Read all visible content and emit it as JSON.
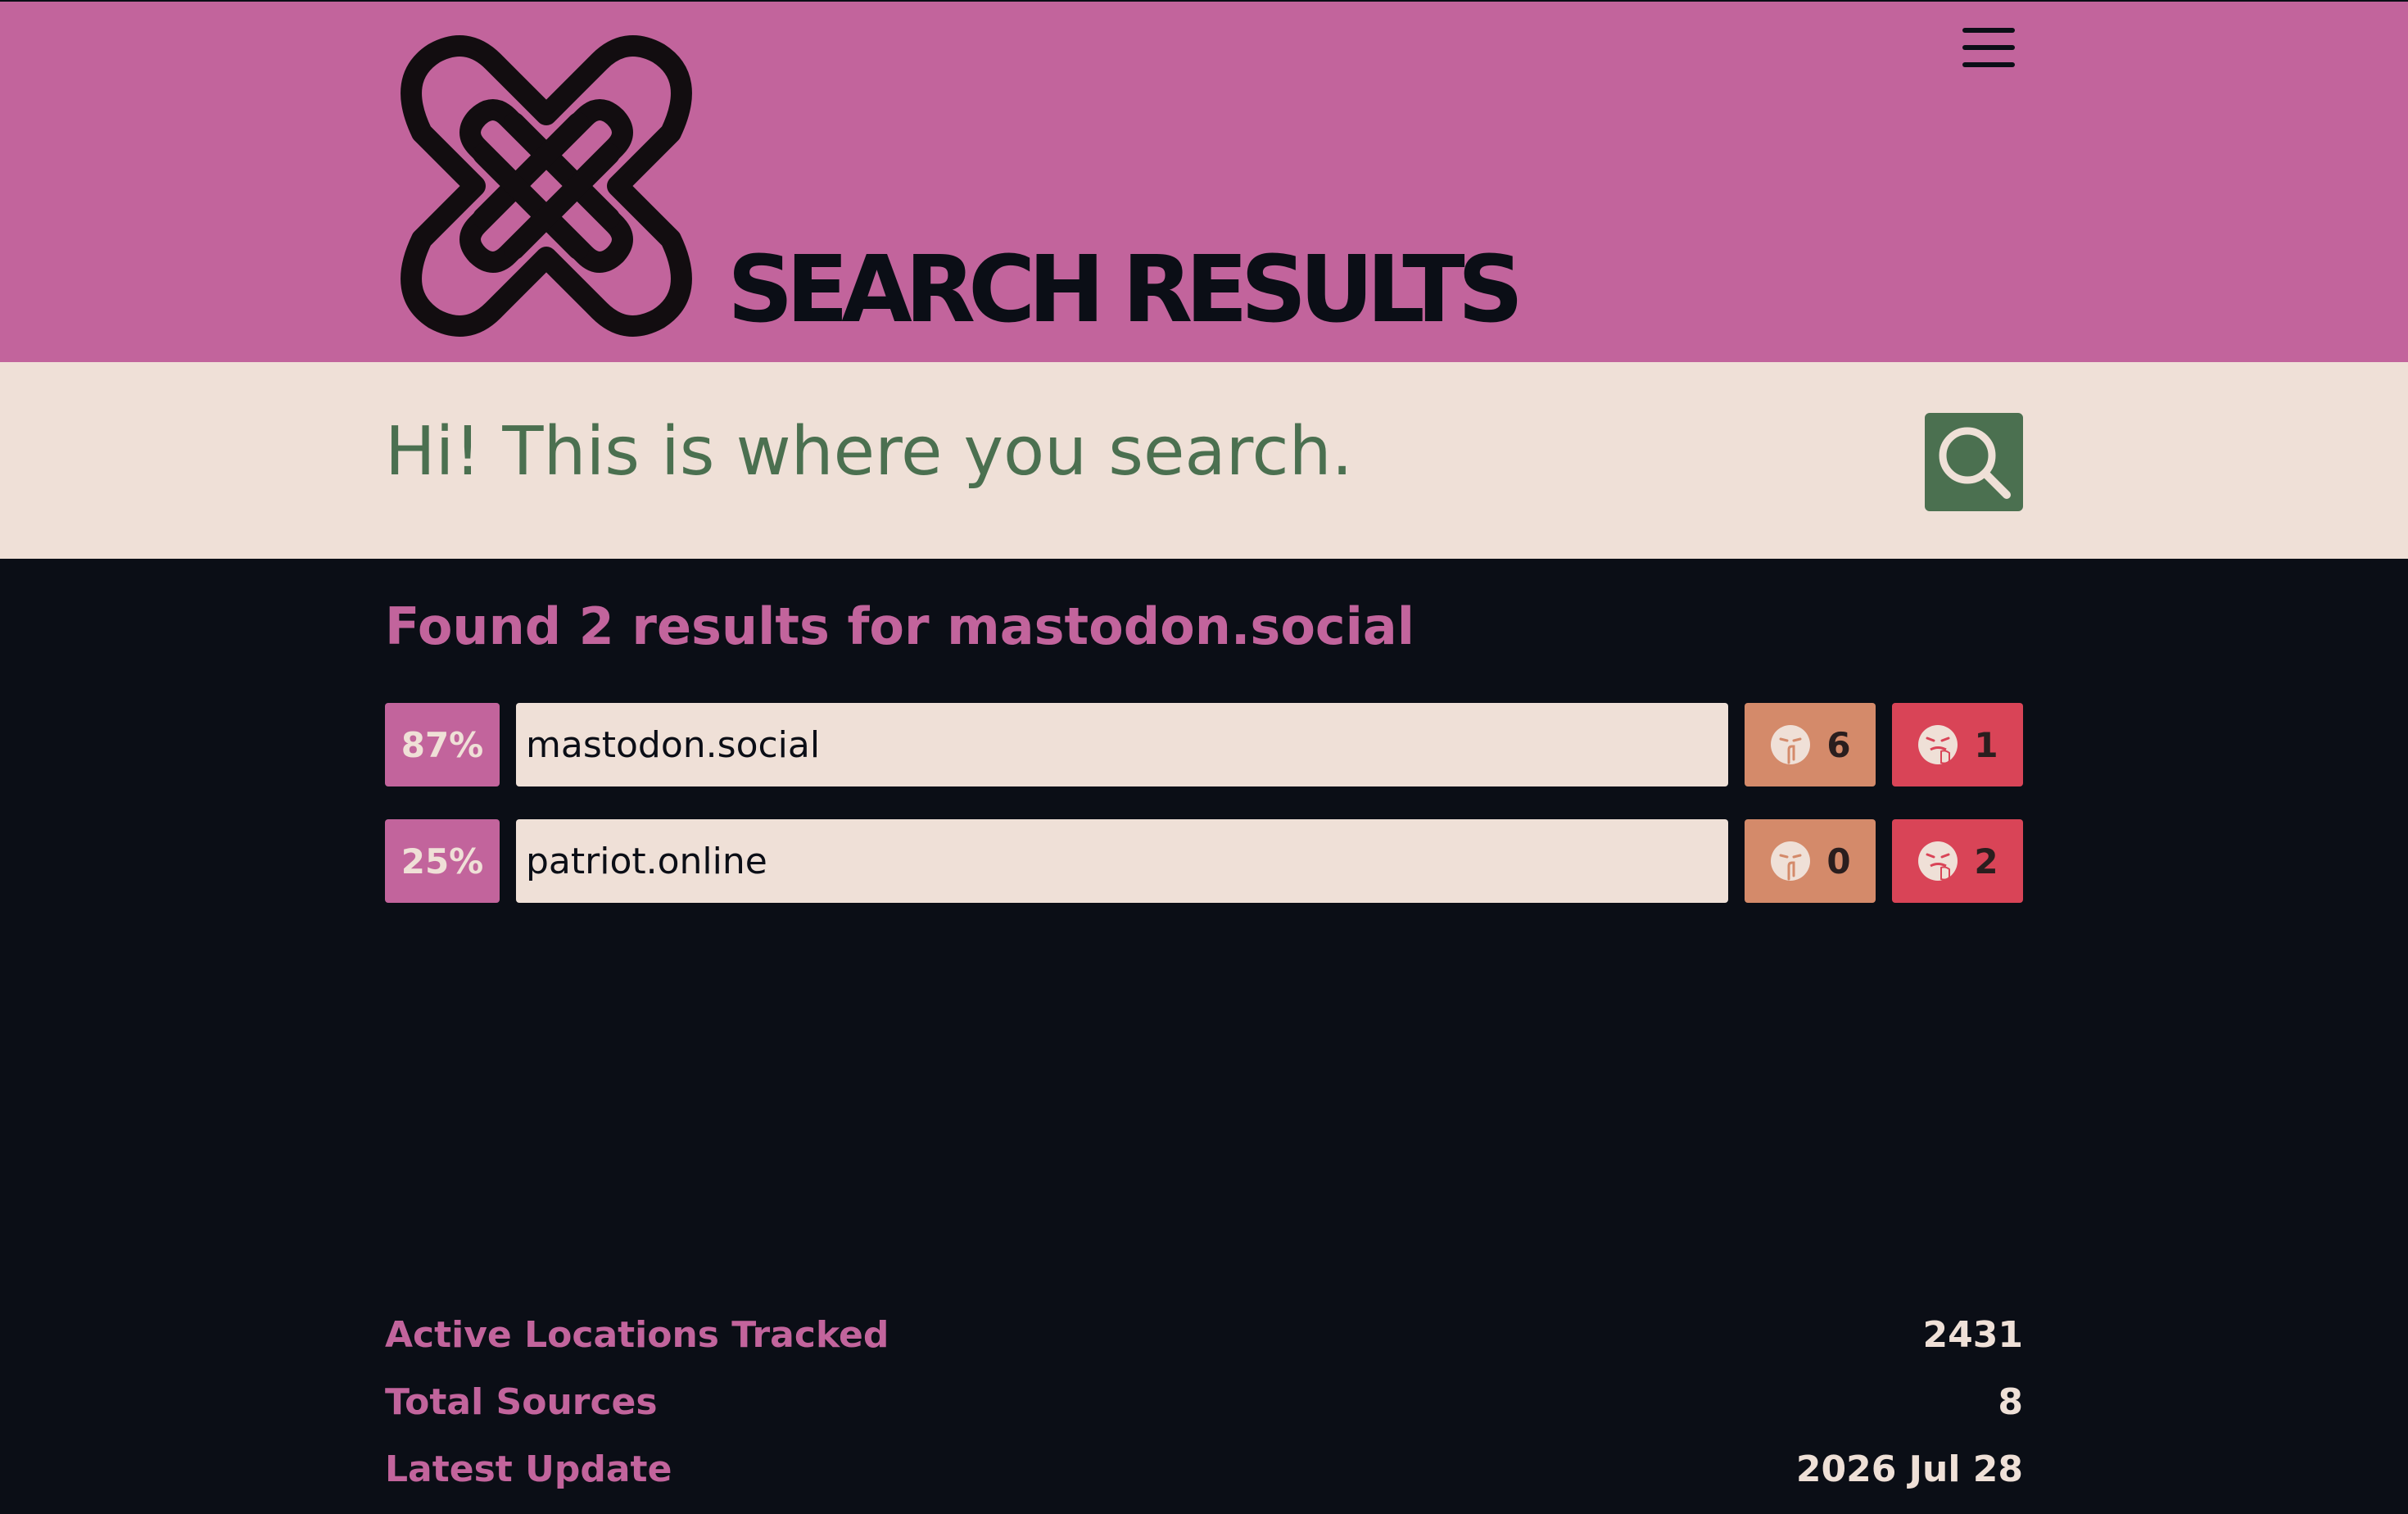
{
  "header": {
    "title": "SEARCH RESULTS",
    "logo_icon": "knot-logo-icon",
    "menu_icon": "hamburger-menu-icon",
    "bg_color": "#c2649c"
  },
  "search": {
    "placeholder": "Hi! This is where you search.",
    "button_icon": "search-icon",
    "button_color": "#4b7050"
  },
  "results": {
    "summary": "Found 2 results for mastodon.social",
    "items": [
      {
        "percent": "87%",
        "domain": "mastodon.social",
        "silenced_count": "6",
        "blocked_count": "1"
      },
      {
        "percent": "25%",
        "domain": "patriot.online",
        "silenced_count": "0",
        "blocked_count": "2"
      }
    ]
  },
  "stats": [
    {
      "label": "Active Locations Tracked",
      "value": "2431"
    },
    {
      "label": "Total Sources",
      "value": "8"
    },
    {
      "label": "Latest Update",
      "value": "2026 Jul 28"
    }
  ],
  "colors": {
    "page_bg": "#0b0e16",
    "accent_pink": "#c2649c",
    "cream": "#efe0d7",
    "silenced_orange": "#d48a6a",
    "blocked_red": "#d94457"
  }
}
